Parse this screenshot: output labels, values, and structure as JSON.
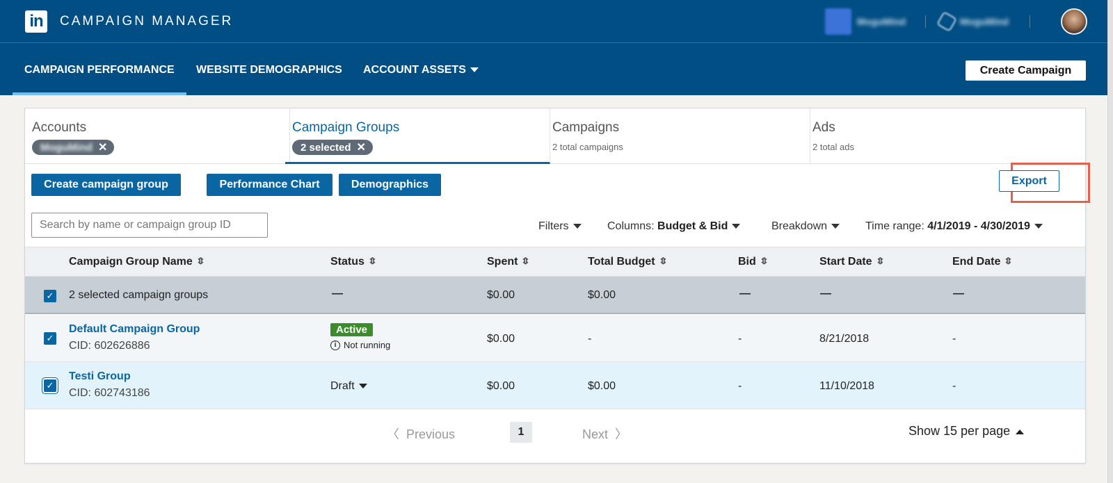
{
  "header": {
    "logo_text": "in",
    "app_title": "CAMPAIGN MANAGER",
    "account_name": "MoguMind",
    "company_name": "MoguMind"
  },
  "nav": {
    "items": [
      {
        "label": "CAMPAIGN PERFORMANCE",
        "active": true
      },
      {
        "label": "WEBSITE DEMOGRAPHICS",
        "active": false
      },
      {
        "label": "ACCOUNT ASSETS",
        "active": false
      }
    ],
    "create_campaign": "Create Campaign"
  },
  "tabs": [
    {
      "title": "Accounts",
      "pill": "MoguMind"
    },
    {
      "title": "Campaign Groups",
      "pill": "2 selected",
      "active": true
    },
    {
      "title": "Campaigns",
      "sub": "2 total campaigns"
    },
    {
      "title": "Ads",
      "sub": "2 total ads"
    }
  ],
  "toolbar": {
    "create_group": "Create campaign group",
    "performance_chart": "Performance Chart",
    "demographics": "Demographics",
    "export": "Export"
  },
  "search": {
    "placeholder": "Search by name or campaign group ID"
  },
  "filters": {
    "filters": "Filters",
    "columns_label": "Columns:",
    "columns_value": "Budget & Bid",
    "breakdown": "Breakdown",
    "time_label": "Time range:",
    "time_value": "4/1/2019 - 4/30/2019"
  },
  "table": {
    "headers": [
      "Campaign Group Name",
      "Status",
      "Spent",
      "Total Budget",
      "Bid",
      "Start Date",
      "End Date"
    ],
    "summary": {
      "name": "2 selected campaign groups",
      "status": "—",
      "spent": "$0.00",
      "budget": "$0.00",
      "bid": "—",
      "start": "—",
      "end": "—"
    },
    "rows": [
      {
        "name": "Default Campaign Group",
        "cid": "CID: 602626886",
        "status": "Active",
        "status_note": "Not running",
        "spent": "$0.00",
        "budget": "-",
        "bid": "-",
        "start": "8/21/2018",
        "end": "-"
      },
      {
        "name": "Testi Group",
        "cid": "CID: 602743186",
        "status": "Draft",
        "spent": "$0.00",
        "budget": "$0.00",
        "bid": "-",
        "start": "11/10/2018",
        "end": "-"
      }
    ]
  },
  "pagination": {
    "previous": "Previous",
    "page": "1",
    "next": "Next",
    "per_page": "Show 15 per page"
  },
  "colors": {
    "header_bg": "#004e84",
    "accent": "#0a66a3",
    "active_badge": "#3b8c2a",
    "highlight_border": "#e3604d"
  }
}
